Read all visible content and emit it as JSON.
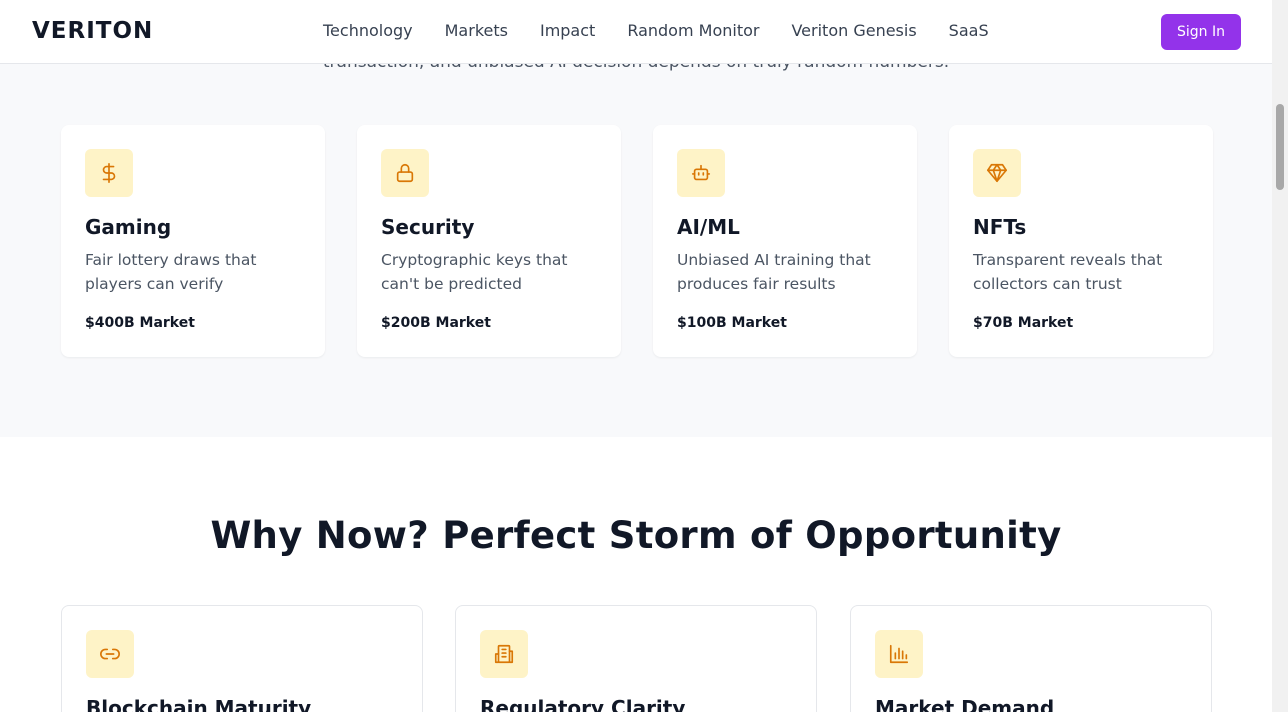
{
  "header": {
    "logo": "VERITON",
    "nav": [
      "Technology",
      "Markets",
      "Impact",
      "Random Monitor",
      "Veriton Genesis",
      "SaaS"
    ],
    "signin_label": "Sign In"
  },
  "intro": {
    "text": "transaction, and unbiased AI decision depends on truly random numbers."
  },
  "markets": [
    {
      "icon": "dollar-icon",
      "title": "Gaming",
      "description": "Fair lottery draws that players can verify",
      "market": "$400B Market"
    },
    {
      "icon": "lock-icon",
      "title": "Security",
      "description": "Cryptographic keys that can't be predicted",
      "market": "$200B Market"
    },
    {
      "icon": "robot-icon",
      "title": "AI/ML",
      "description": "Unbiased AI training that produces fair results",
      "market": "$100B Market"
    },
    {
      "icon": "gem-icon",
      "title": "NFTs",
      "description": "Transparent reveals that collectors can trust",
      "market": "$70B Market"
    }
  ],
  "why_now": {
    "title": "Why Now? Perfect Storm of Opportunity",
    "cards": [
      {
        "icon": "link-icon",
        "title": "Blockchain Maturity"
      },
      {
        "icon": "building-icon",
        "title": "Regulatory Clarity"
      },
      {
        "icon": "bar-chart-icon",
        "title": "Market Demand"
      }
    ]
  },
  "colors": {
    "accent": "#9333ea",
    "icon_bg": "#fef3c7",
    "icon_stroke": "#d97706",
    "section_bg": "#f8f9fb"
  }
}
